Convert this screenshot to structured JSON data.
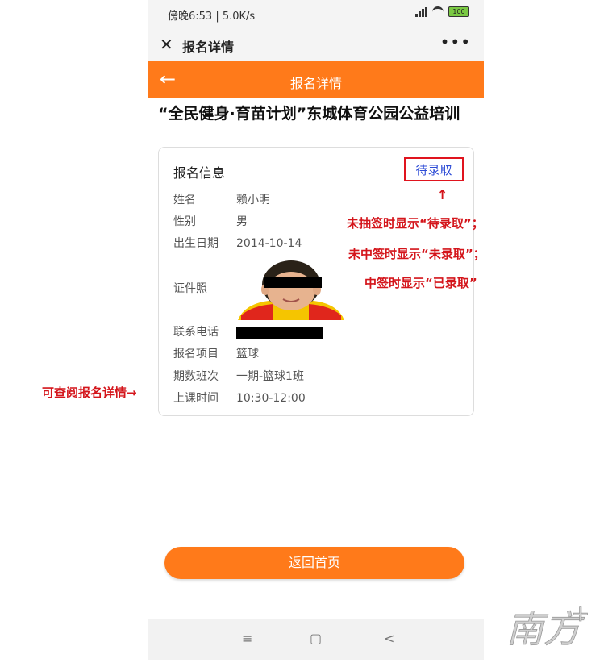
{
  "status_bar": {
    "time_text": "傍晚6:53 | 5.0K/s",
    "battery": "100"
  },
  "wechat_bar": {
    "title": "报名详情"
  },
  "app_header": {
    "title": "报名详情"
  },
  "page_title": "“全民健身·育苗计划”东城体育公园公益培训",
  "card": {
    "heading": "报名信息",
    "status": "待录取",
    "fields": [
      {
        "label": "姓名",
        "value": "赖小明"
      },
      {
        "label": "性别",
        "value": "男"
      },
      {
        "label": "出生日期",
        "value": "2014-10-14"
      },
      {
        "label": "证件照",
        "value": ""
      },
      {
        "label": "联系电话",
        "value": ""
      },
      {
        "label": "报名项目",
        "value": "篮球"
      },
      {
        "label": "期数班次",
        "value": "一期-篮球1班"
      },
      {
        "label": "上课时间",
        "value": "10:30-12:00"
      }
    ]
  },
  "annotations": {
    "line1": "未抽签时显示“待录取”；",
    "line2": "未中签时显示“未录取”；",
    "line3": "中签时显示“已录取”",
    "left_note": "可查阅报名详情→",
    "up_arrow": "↑",
    "color": "#d4151b"
  },
  "return_button": "返回首页",
  "nav": {
    "menu": "≡",
    "home": "▢",
    "back": "<"
  },
  "watermark": "南方+",
  "colors": {
    "accent": "#ff7a1a",
    "status_link": "#2c4bd6",
    "status_border": "#e0141e"
  }
}
